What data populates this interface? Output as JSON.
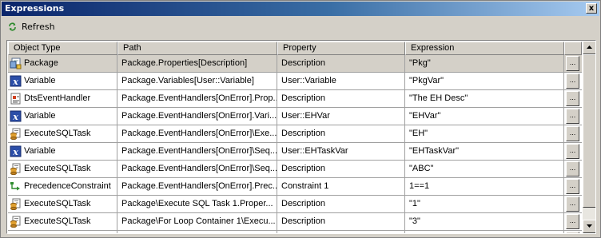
{
  "window": {
    "title": "Expressions",
    "close_label": "x"
  },
  "toolbar": {
    "refresh_label": "Refresh",
    "refresh_icon": "refresh-icon"
  },
  "columns": [
    "Object Type",
    "Path",
    "Property",
    "Expression"
  ],
  "ellipsis_label": "...",
  "rows": [
    {
      "icon": "package-icon",
      "type": "Package",
      "path": "Package.Properties[Description]",
      "property": "Description",
      "expression": "\"Pkg\"",
      "selected": true
    },
    {
      "icon": "variable-icon",
      "type": "Variable",
      "path": "Package.Variables[User::Variable]",
      "property": "User::Variable",
      "expression": "\"PkgVar\""
    },
    {
      "icon": "event-handler-icon",
      "type": "DtsEventHandler",
      "path": "Package.EventHandlers[OnError].Prop...",
      "property": "Description",
      "expression": "\"The EH Desc\""
    },
    {
      "icon": "variable-icon",
      "type": "Variable",
      "path": "Package.EventHandlers[OnError].Vari...",
      "property": "User::EHVar",
      "expression": "\"EHVar\""
    },
    {
      "icon": "sql-task-icon",
      "type": "ExecuteSQLTask",
      "path": "Package.EventHandlers[OnError]\\Exe...",
      "property": "Description",
      "expression": "\"EH\""
    },
    {
      "icon": "variable-icon",
      "type": "Variable",
      "path": "Package.EventHandlers[OnError]\\Seq...",
      "property": "User::EHTaskVar",
      "expression": "\"EHTaskVar\""
    },
    {
      "icon": "sql-task-icon",
      "type": "ExecuteSQLTask",
      "path": "Package.EventHandlers[OnError]\\Seq...",
      "property": "Description",
      "expression": "\"ABC\""
    },
    {
      "icon": "precedence-constraint-icon",
      "type": "PrecedenceConstraint",
      "path": "Package.EventHandlers[OnError].Prec...",
      "property": "Constraint 1",
      "expression": "1==1"
    },
    {
      "icon": "sql-task-icon",
      "type": "ExecuteSQLTask",
      "path": "Package\\Execute SQL Task 1.Proper...",
      "property": "Description",
      "expression": "\"1\""
    },
    {
      "icon": "sql-task-icon",
      "type": "ExecuteSQLTask",
      "path": "Package\\For Loop Container 1\\Execu...",
      "property": "Description",
      "expression": "\"3\""
    },
    {
      "icon": "sql-task-icon",
      "type": "",
      "path": "",
      "property": "",
      "expression": ""
    }
  ],
  "colors": {
    "selected_row": "#d4d0c8",
    "title_start": "#0a246a",
    "title_end": "#a6caf0"
  }
}
